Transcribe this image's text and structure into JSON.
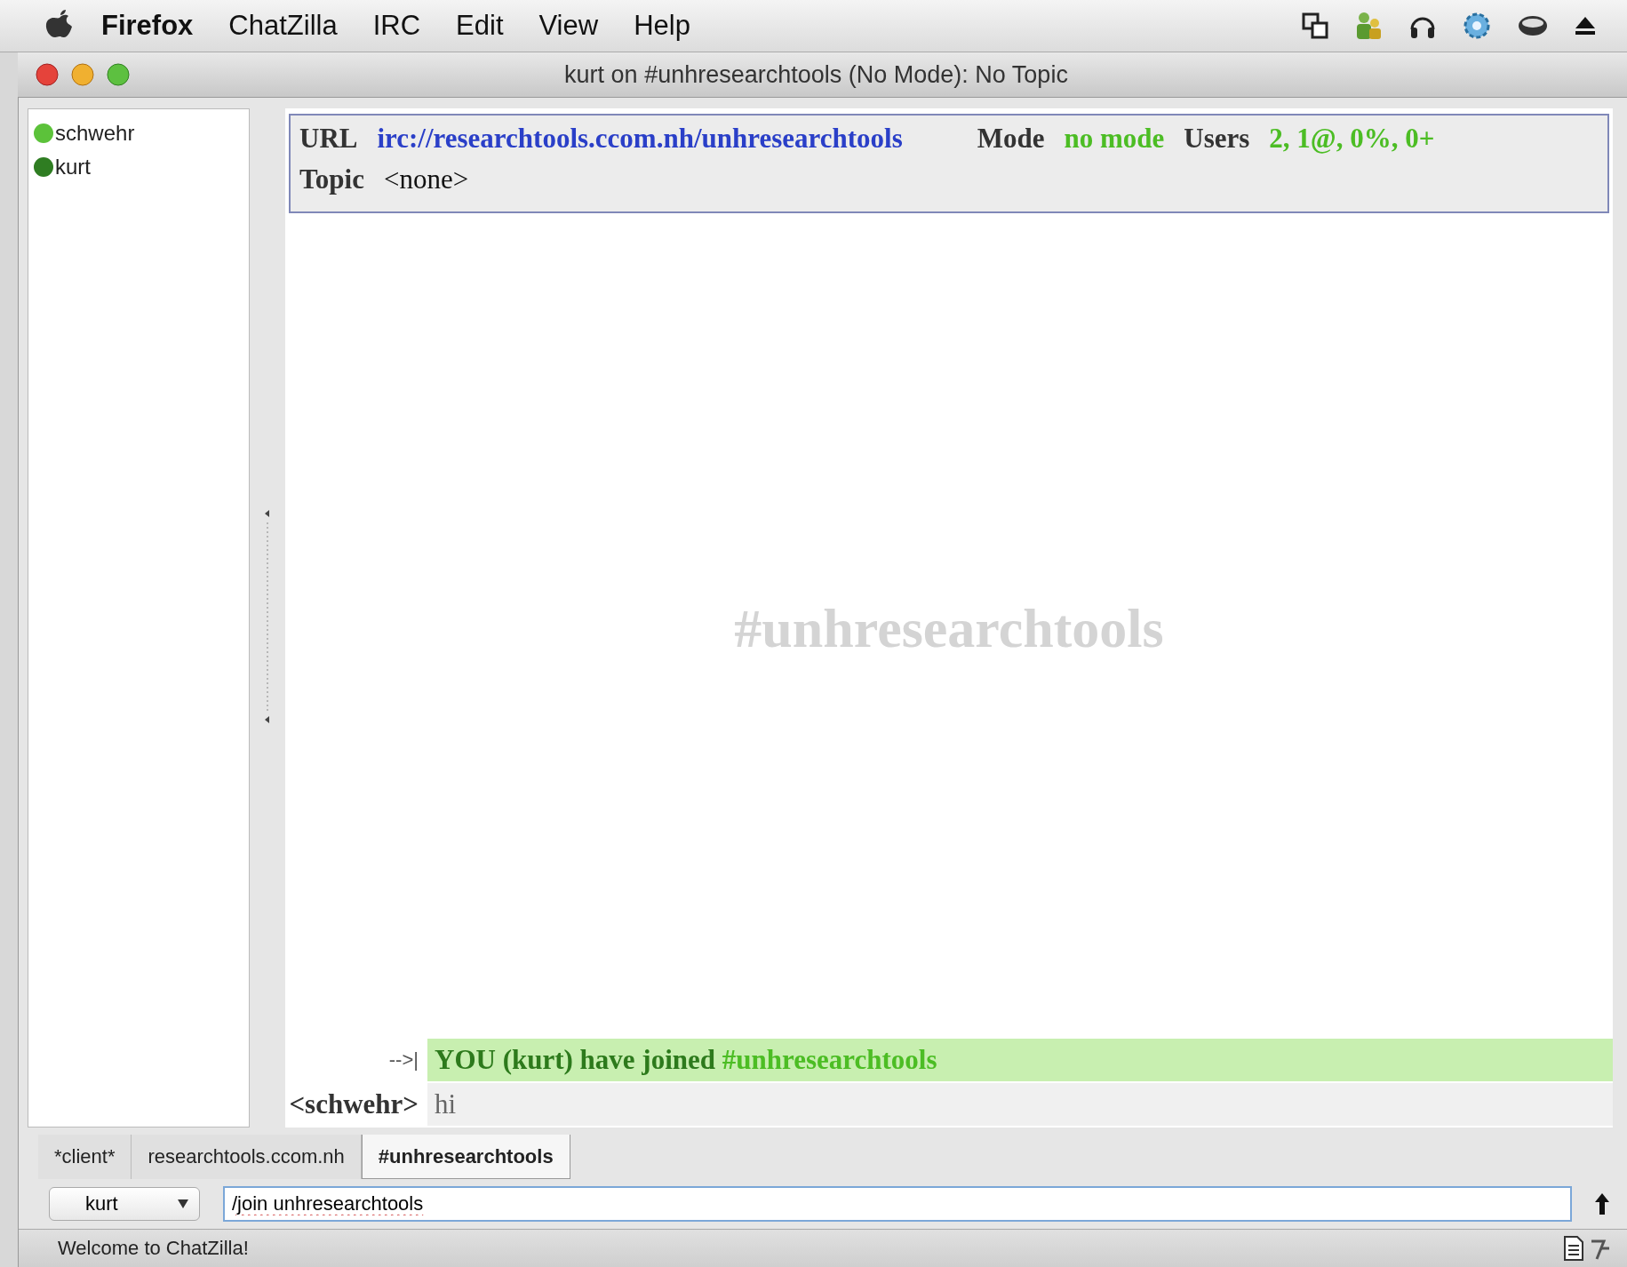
{
  "menubar": {
    "app_name": "Firefox",
    "items": [
      "ChatZilla",
      "IRC",
      "Edit",
      "View",
      "Help"
    ]
  },
  "window": {
    "title": "kurt on #unhresearchtools (No Mode): No Topic"
  },
  "users": [
    {
      "name": "schwehr",
      "color": "#5cc23a"
    },
    {
      "name": "kurt",
      "color": "#2f7d22"
    }
  ],
  "header": {
    "url_label": "URL",
    "url": "irc://researchtools.ccom.nh/unhresearchtools",
    "mode_label": "Mode",
    "mode": "no mode",
    "users_label": "Users",
    "users": "2, 1@, 0%, 0+",
    "topic_label": "Topic",
    "topic": "<none>"
  },
  "channel_watermark": "#unhresearchtools",
  "messages": [
    {
      "kind": "join",
      "prefix": "-->|",
      "text": "YOU (kurt) have joined",
      "channel": "#unhresearchtools"
    },
    {
      "kind": "message",
      "prefix": "<schwehr>",
      "text": "hi"
    }
  ],
  "tabs": [
    {
      "label": "*client*",
      "selected": false
    },
    {
      "label": "researchtools.ccom.nh",
      "selected": false
    },
    {
      "label": "#unhresearchtools",
      "selected": true
    }
  ],
  "input": {
    "nick": "kurt",
    "value": "/join unhresearchtools"
  },
  "status_bar": "Welcome to ChatZilla!"
}
